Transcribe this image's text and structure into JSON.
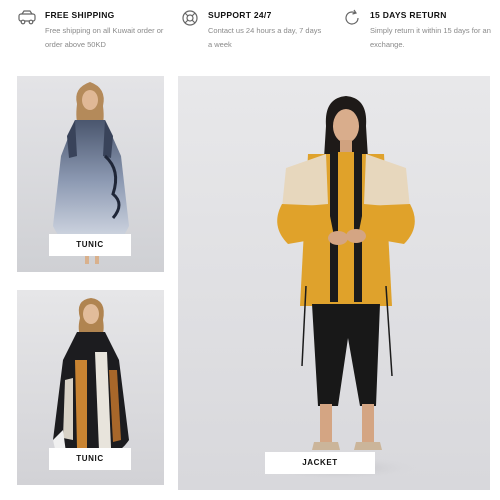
{
  "features": [
    {
      "icon": "truck-icon",
      "title": "FREE SHIPPING",
      "desc": "Free shipping on all Kuwait order or order above 50KD"
    },
    {
      "icon": "lifebuoy-icon",
      "title": "SUPPORT 24/7",
      "desc": "Contact us 24 hours a day, 7 days a week"
    },
    {
      "icon": "refresh-icon",
      "title": "15 DAYS RETURN",
      "desc": "Simply return it within 15 days for an exchange."
    }
  ],
  "products": [
    {
      "label": "TUNIC"
    },
    {
      "label": "TUNIC"
    },
    {
      "label": "JACKET"
    }
  ],
  "colors": {
    "accent_mustard": "#e0a22a",
    "text_muted": "#8a8a8a"
  }
}
